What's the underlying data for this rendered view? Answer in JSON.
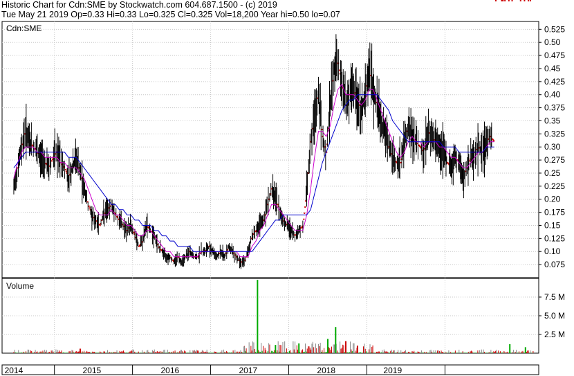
{
  "header": {
    "line1": "Historic Chart for Cdn:SME by Stockwatch.com 604.687.1500 - (c) 2019",
    "line2": "Tue May 21 2019  Op=0.33  Hi=0.33  Lo=0.325  Cl=0.325  Vol=18,200  Year hi=0.50  lo=0.07"
  },
  "chart_data": [
    {
      "type": "line",
      "panel": "price",
      "title": "Cdn:SME",
      "ylim": [
        0.05,
        0.54
      ],
      "yticks": [
        "0.075",
        "0.10",
        "0.125",
        "0.15",
        "0.175",
        "0.20",
        "0.225",
        "0.25",
        "0.275",
        "0.30",
        "0.325",
        "0.35",
        "0.375",
        "0.40",
        "0.425",
        "0.45",
        "0.475",
        "0.50",
        "0.525"
      ],
      "x_labels": [
        "2014",
        "2015",
        "2016",
        "2017",
        "2018",
        "2019"
      ],
      "grid": true,
      "colors": {
        "price": "#000000",
        "ma_short": "#cc00cc",
        "ma_long": "#0000cc",
        "down_day": "#cc0000"
      },
      "x": [
        0.0,
        0.05,
        0.1,
        0.15,
        0.2,
        0.25,
        0.3,
        0.35,
        0.4,
        0.45,
        0.5,
        0.55,
        0.6,
        0.65,
        0.7,
        0.75,
        0.8,
        0.85,
        0.9,
        0.95,
        1.0,
        1.05,
        1.1,
        1.15,
        1.2,
        1.25,
        1.3,
        1.35,
        1.4,
        1.45,
        1.5,
        1.55,
        1.6,
        1.65,
        1.7,
        1.75,
        1.8,
        1.85,
        1.9,
        1.95,
        2.0,
        2.05,
        2.1,
        2.15,
        2.2,
        2.25,
        2.3,
        2.35,
        2.4,
        2.45,
        2.5,
        2.55,
        2.6,
        2.65,
        2.7,
        2.75,
        2.8,
        2.85,
        2.9,
        2.95,
        3.0,
        3.05,
        3.1,
        3.15,
        3.2,
        3.25,
        3.3,
        3.35,
        3.4,
        3.45,
        3.5,
        3.55,
        3.6,
        3.65,
        3.7,
        3.75,
        3.8,
        3.85,
        3.9,
        3.95,
        4.0,
        4.05,
        4.1,
        4.15,
        4.2,
        4.25,
        4.3,
        4.35,
        4.4,
        4.45,
        4.5,
        4.55,
        4.6,
        4.65,
        4.7,
        4.75,
        4.8,
        4.85,
        4.9,
        4.95,
        5.0,
        5.05,
        5.1,
        5.15,
        5.2,
        5.25,
        5.3,
        5.35,
        5.4,
        5.45,
        5.5,
        5.55,
        5.6,
        5.65,
        5.7,
        5.75,
        5.8,
        5.85,
        5.9,
        5.95,
        6.0,
        6.05,
        6.1,
        6.15,
        6.2,
        6.25,
        6.3,
        6.35,
        6.4,
        6.45,
        6.5,
        6.55,
        6.6,
        6.65
      ],
      "series": [
        {
          "values": [
            0.22,
            0.26,
            0.3,
            0.33,
            0.31,
            0.3,
            0.29,
            0.28,
            0.27,
            0.26,
            0.28,
            0.29,
            0.27,
            0.26,
            0.24,
            0.26,
            0.28,
            0.25,
            0.22,
            0.19,
            0.17,
            0.16,
            0.15,
            0.17,
            0.18,
            0.19,
            0.17,
            0.16,
            0.15,
            0.14,
            0.15,
            0.13,
            0.11,
            0.12,
            0.15,
            0.14,
            0.13,
            0.11,
            0.1,
            0.09,
            0.09,
            0.08,
            0.09,
            0.08,
            0.09,
            0.1,
            0.09,
            0.09,
            0.1,
            0.1,
            0.11,
            0.1,
            0.09,
            0.1,
            0.09,
            0.11,
            0.1,
            0.09,
            0.08,
            0.08,
            0.1,
            0.13,
            0.14,
            0.15,
            0.16,
            0.19,
            0.22,
            0.2,
            0.18,
            0.16,
            0.15,
            0.14,
            0.13,
            0.14,
            0.15,
            0.22,
            0.31,
            0.36,
            0.4,
            0.32,
            0.29,
            0.38,
            0.45,
            0.46,
            0.42,
            0.38,
            0.4,
            0.41,
            0.39,
            0.37,
            0.4,
            0.45,
            0.41,
            0.38,
            0.35,
            0.33,
            0.3,
            0.28,
            0.27,
            0.27,
            0.31,
            0.34,
            0.32,
            0.31,
            0.3,
            0.29,
            0.33,
            0.32,
            0.31,
            0.3,
            0.29,
            0.27,
            0.26,
            0.28,
            0.27,
            0.24,
            0.26,
            0.28,
            0.29,
            0.3,
            0.29,
            0.31,
            0.32,
            0.31
          ]
        },
        {
          "values": [
            0.24,
            0.27,
            0.29,
            0.3,
            0.3,
            0.3,
            0.29,
            0.29,
            0.28,
            0.28,
            0.28,
            0.28,
            0.27,
            0.27,
            0.26,
            0.26,
            0.26,
            0.25,
            0.24,
            0.22,
            0.2,
            0.18,
            0.17,
            0.17,
            0.17,
            0.18,
            0.17,
            0.17,
            0.16,
            0.15,
            0.15,
            0.14,
            0.13,
            0.13,
            0.14,
            0.14,
            0.13,
            0.12,
            0.11,
            0.1,
            0.1,
            0.09,
            0.09,
            0.09,
            0.09,
            0.09,
            0.09,
            0.09,
            0.1,
            0.1,
            0.1,
            0.1,
            0.1,
            0.1,
            0.1,
            0.1,
            0.1,
            0.1,
            0.09,
            0.09,
            0.09,
            0.11,
            0.12,
            0.14,
            0.15,
            0.17,
            0.19,
            0.19,
            0.18,
            0.17,
            0.16,
            0.15,
            0.14,
            0.14,
            0.14,
            0.17,
            0.22,
            0.28,
            0.33,
            0.33,
            0.32,
            0.34,
            0.38,
            0.41,
            0.42,
            0.4,
            0.4,
            0.4,
            0.39,
            0.38,
            0.39,
            0.41,
            0.41,
            0.39,
            0.37,
            0.35,
            0.33,
            0.31,
            0.29,
            0.28,
            0.29,
            0.31,
            0.32,
            0.31,
            0.31,
            0.3,
            0.31,
            0.31,
            0.31,
            0.3,
            0.3,
            0.29,
            0.28,
            0.28,
            0.27,
            0.26,
            0.26,
            0.27,
            0.28,
            0.29,
            0.29,
            0.3,
            0.31,
            0.31
          ]
        },
        {
          "values": [
            0.26,
            0.27,
            0.28,
            0.29,
            0.29,
            0.29,
            0.29,
            0.29,
            0.29,
            0.29,
            0.29,
            0.29,
            0.29,
            0.29,
            0.28,
            0.28,
            0.28,
            0.27,
            0.26,
            0.25,
            0.24,
            0.23,
            0.22,
            0.21,
            0.2,
            0.19,
            0.19,
            0.18,
            0.18,
            0.17,
            0.17,
            0.16,
            0.16,
            0.15,
            0.15,
            0.15,
            0.14,
            0.14,
            0.13,
            0.13,
            0.12,
            0.12,
            0.11,
            0.11,
            0.11,
            0.11,
            0.1,
            0.1,
            0.1,
            0.1,
            0.1,
            0.1,
            0.1,
            0.1,
            0.1,
            0.1,
            0.1,
            0.1,
            0.1,
            0.1,
            0.1,
            0.1,
            0.11,
            0.12,
            0.13,
            0.14,
            0.15,
            0.16,
            0.16,
            0.17,
            0.17,
            0.17,
            0.17,
            0.17,
            0.17,
            0.17,
            0.18,
            0.21,
            0.24,
            0.27,
            0.29,
            0.31,
            0.33,
            0.35,
            0.37,
            0.38,
            0.39,
            0.39,
            0.4,
            0.4,
            0.4,
            0.4,
            0.4,
            0.4,
            0.39,
            0.38,
            0.37,
            0.35,
            0.34,
            0.33,
            0.32,
            0.31,
            0.31,
            0.31,
            0.31,
            0.31,
            0.31,
            0.31,
            0.31,
            0.31,
            0.3,
            0.3,
            0.3,
            0.3,
            0.29,
            0.29,
            0.29,
            0.29,
            0.29,
            0.29,
            0.29,
            0.3,
            0.3,
            0.3
          ]
        }
      ]
    },
    {
      "type": "bar",
      "panel": "volume",
      "title": "Volume",
      "ylim": [
        0,
        10
      ],
      "yticks": [
        "2.5 M",
        "5.0 M",
        "7.5 M"
      ],
      "y_tick_values": [
        2.5,
        5.0,
        7.5
      ],
      "colors": {
        "up": "#00aa00",
        "down": "#cc0000",
        "flat": "#888888"
      },
      "spikes": [
        {
          "x": 3.12,
          "value": 9.8,
          "color": "up"
        },
        {
          "x": 4.12,
          "value": 3.5,
          "color": "up"
        },
        {
          "x": 4.02,
          "value": 1.9,
          "color": "up"
        },
        {
          "x": 4.25,
          "value": 1.6,
          "color": "down"
        },
        {
          "x": 2.95,
          "value": 0.9,
          "color": "flat"
        },
        {
          "x": 6.35,
          "value": 1.2,
          "color": "up"
        },
        {
          "x": 3.35,
          "value": 1.1,
          "color": "up"
        },
        {
          "x": 3.65,
          "value": 1.3,
          "color": "up"
        },
        {
          "x": 4.4,
          "value": 1.0,
          "color": "down"
        },
        {
          "x": 6.55,
          "value": 0.8,
          "color": "up"
        },
        {
          "x": 0.85,
          "value": 0.6,
          "color": "down"
        }
      ]
    }
  ],
  "x_axis": {
    "labels": [
      "2014",
      "2015",
      "2016",
      "2017",
      "2018",
      "2019"
    ]
  }
}
